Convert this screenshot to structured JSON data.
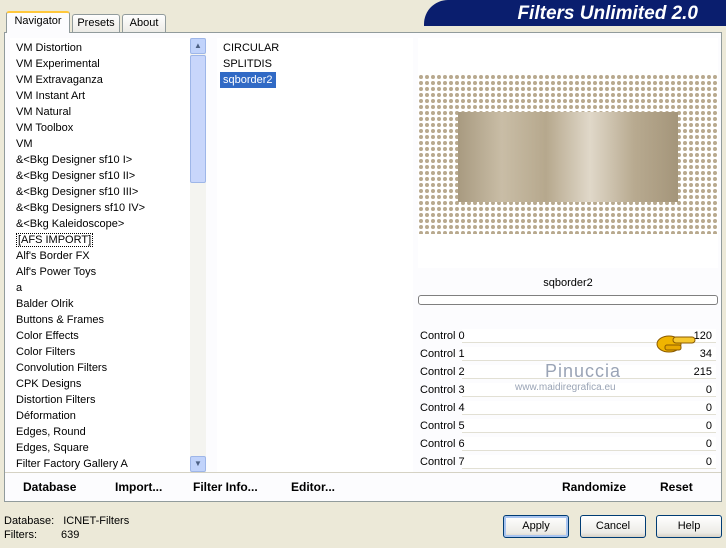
{
  "tabs": [
    {
      "label": "Navigator",
      "active": true
    },
    {
      "label": "Presets",
      "active": false
    },
    {
      "label": "About",
      "active": false
    }
  ],
  "banner": {
    "title": "Filters Unlimited 2.0"
  },
  "categories": [
    "VM Distortion",
    "VM Experimental",
    "VM Extravaganza",
    "VM Instant Art",
    "VM Natural",
    "VM Toolbox",
    "VM",
    "&<Bkg Designer sf10 I>",
    "&<Bkg Designer sf10 II>",
    "&<Bkg Designer sf10 III>",
    "&<Bkg Designers sf10 IV>",
    "&<Bkg Kaleidoscope>",
    "[AFS IMPORT]",
    "Alf's Border FX",
    "Alf's Power Toys",
    "a",
    "Balder Olrik",
    "Buttons & Frames",
    "Color Effects",
    "Color Filters",
    "Convolution Filters",
    "CPK Designs",
    "Distortion Filters",
    "Déformation",
    "Edges, Round",
    "Edges, Square",
    "Filter Factory Gallery A"
  ],
  "filters": [
    "CIRCULAR",
    "SPLITDIS",
    "sqborder2"
  ],
  "selected_filter": "sqborder2",
  "preview": {
    "filter_name": "sqborder2"
  },
  "watermark": {
    "name": "Pinuccia",
    "url": "www.maidiregrafica.eu"
  },
  "controls": [
    {
      "label": "Control 0",
      "value": "120"
    },
    {
      "label": "Control 1",
      "value": "34"
    },
    {
      "label": "Control 2",
      "value": "215"
    },
    {
      "label": "Control 3",
      "value": "0"
    },
    {
      "label": "Control 4",
      "value": "0"
    },
    {
      "label": "Control 5",
      "value": "0"
    },
    {
      "label": "Control 6",
      "value": "0"
    },
    {
      "label": "Control 7",
      "value": "0"
    }
  ],
  "toolbar": {
    "database": "Database",
    "import": "Import...",
    "filter_info": "Filter Info...",
    "editor": "Editor...",
    "randomize": "Randomize",
    "reset": "Reset"
  },
  "status": {
    "database_label": "Database:",
    "database_value": "ICNET-Filters",
    "filters_label": "Filters:",
    "filters_value": "639"
  },
  "buttons": {
    "apply": "Apply",
    "cancel": "Cancel",
    "help": "Help"
  },
  "colors": {
    "banner": "#0a1e6e",
    "selection": "#316ac5",
    "preview_tan": "#b8a98e"
  }
}
